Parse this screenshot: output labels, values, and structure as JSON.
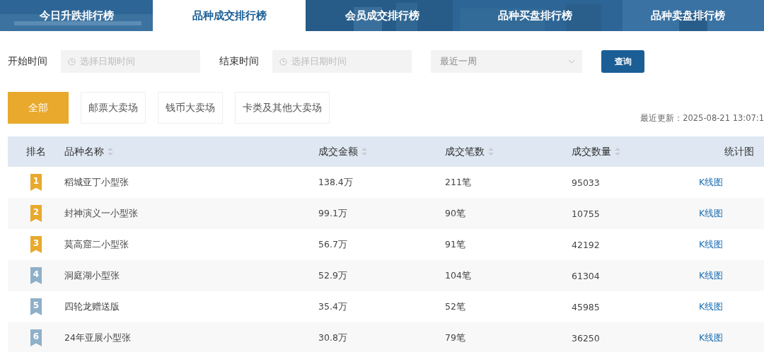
{
  "tabs": [
    {
      "label": "今日升跌排行榜",
      "selected": false
    },
    {
      "label": "品种成交排行榜",
      "selected": true
    },
    {
      "label": "会员成交排行榜",
      "selected": false
    },
    {
      "label": "品种买盘排行榜",
      "selected": false
    },
    {
      "label": "品种卖盘排行榜",
      "selected": false
    }
  ],
  "filters": {
    "start_label": "开始时间",
    "start_placeholder": "选择日期时间",
    "end_label": "结束时间",
    "end_placeholder": "选择日期时间",
    "period": "最近一周",
    "query_button": "查询"
  },
  "markets": [
    {
      "label": "全部",
      "selected": true
    },
    {
      "label": "邮票大卖场",
      "selected": false
    },
    {
      "label": "钱币大卖场",
      "selected": false
    },
    {
      "label": "卡类及其他大卖场",
      "selected": false
    }
  ],
  "last_updated": "最近更新：2025-08-21 13:07:1",
  "table": {
    "columns": [
      {
        "label": "排名",
        "sortable": false
      },
      {
        "label": "品种名称",
        "sortable": true
      },
      {
        "label": "成交金额",
        "sortable": true
      },
      {
        "label": "成交笔数",
        "sortable": true
      },
      {
        "label": "成交数量",
        "sortable": true
      },
      {
        "label": "统计图",
        "sortable": false
      }
    ],
    "rows": [
      {
        "rank": "1",
        "color": "#e8a92c",
        "name": "稻城亚丁小型张",
        "amount": "138.4万",
        "count": "211笔",
        "quantity": "95033",
        "chart_link": "K线图"
      },
      {
        "rank": "2",
        "color": "#e8a92c",
        "name": "封神演义一小型张",
        "amount": "99.1万",
        "count": "90笔",
        "quantity": "10755",
        "chart_link": "K线图"
      },
      {
        "rank": "3",
        "color": "#e8a92c",
        "name": "莫高窟二小型张",
        "amount": "56.7万",
        "count": "91笔",
        "quantity": "42192",
        "chart_link": "K线图"
      },
      {
        "rank": "4",
        "color": "#8fb0c9",
        "name": "洞庭湖小型张",
        "amount": "52.9万",
        "count": "104笔",
        "quantity": "61304",
        "chart_link": "K线图"
      },
      {
        "rank": "5",
        "color": "#8fb0c9",
        "name": "四轮龙赠送版",
        "amount": "35.4万",
        "count": "52笔",
        "quantity": "45985",
        "chart_link": "K线图"
      },
      {
        "rank": "6",
        "color": "#8fb0c9",
        "name": "24年亚展小型张",
        "amount": "30.8万",
        "count": "79笔",
        "quantity": "36250",
        "chart_link": "K线图"
      }
    ]
  }
}
